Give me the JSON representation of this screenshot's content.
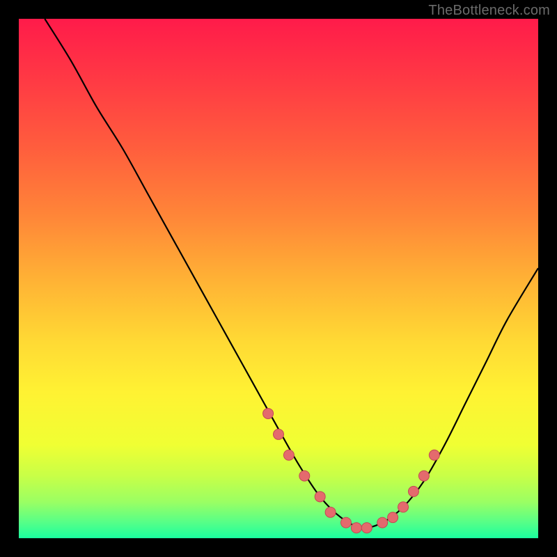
{
  "watermark": "TheBottleneck.com",
  "colors": {
    "frame": "#000000",
    "curve_stroke": "#000000",
    "marker_fill": "#e46a6d",
    "marker_stroke": "#c24a53",
    "gradient_stops": [
      {
        "offset": 0.0,
        "color": "#ff1b4a"
      },
      {
        "offset": 0.12,
        "color": "#ff3a44"
      },
      {
        "offset": 0.25,
        "color": "#ff5e3d"
      },
      {
        "offset": 0.38,
        "color": "#ff8638"
      },
      {
        "offset": 0.5,
        "color": "#ffb135"
      },
      {
        "offset": 0.62,
        "color": "#ffd934"
      },
      {
        "offset": 0.72,
        "color": "#fff233"
      },
      {
        "offset": 0.82,
        "color": "#f0ff33"
      },
      {
        "offset": 0.88,
        "color": "#c8ff47"
      },
      {
        "offset": 0.93,
        "color": "#9bff63"
      },
      {
        "offset": 0.97,
        "color": "#55ff88"
      },
      {
        "offset": 1.0,
        "color": "#1aff9e"
      }
    ]
  },
  "chart_data": {
    "type": "line",
    "title": "",
    "xlabel": "",
    "ylabel": "",
    "xlim": [
      0,
      100
    ],
    "ylim": [
      0,
      100
    ],
    "grid": false,
    "series": [
      {
        "name": "bottleneck-curve",
        "x": [
          5,
          10,
          15,
          20,
          25,
          30,
          35,
          40,
          45,
          50,
          54,
          58,
          62,
          66,
          70,
          74,
          78,
          82,
          86,
          90,
          94,
          100
        ],
        "values": [
          100,
          92,
          83,
          75,
          66,
          57,
          48,
          39,
          30,
          21,
          14,
          8,
          4,
          2,
          3,
          6,
          11,
          18,
          26,
          34,
          42,
          52
        ]
      }
    ],
    "markers": {
      "name": "highlighted-points",
      "x": [
        48,
        50,
        52,
        55,
        58,
        60,
        63,
        65,
        67,
        70,
        72,
        74,
        76,
        78,
        80
      ],
      "values": [
        24,
        20,
        16,
        12,
        8,
        5,
        3,
        2,
        2,
        3,
        4,
        6,
        9,
        12,
        16
      ]
    }
  }
}
